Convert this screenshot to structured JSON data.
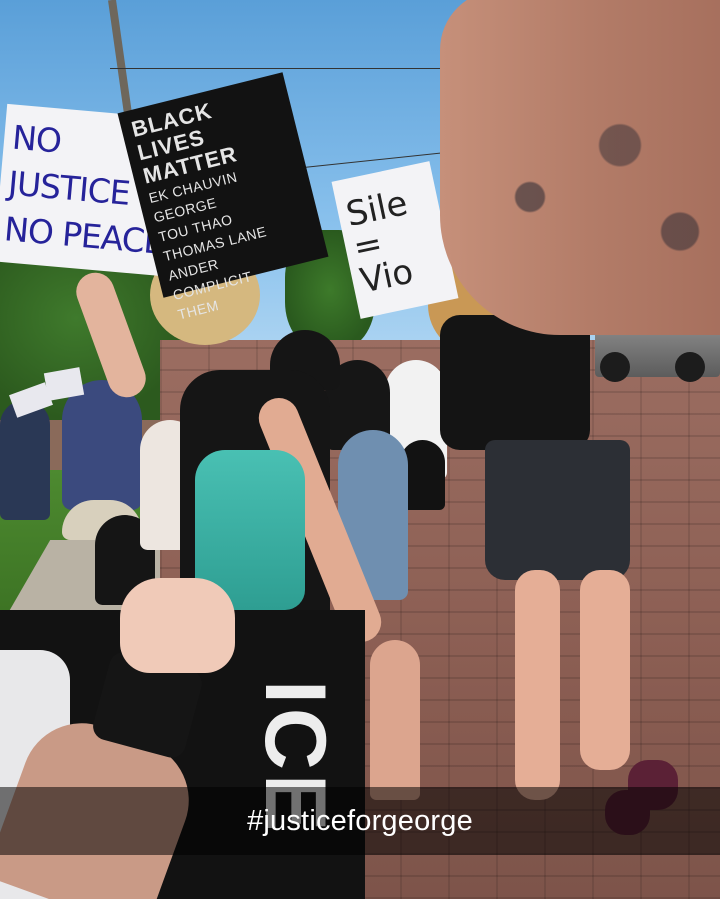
{
  "photo": {
    "description_icon": "protest-march-photo-icon"
  },
  "signs": {
    "no_justice": {
      "line1": "NO JUSTICE",
      "line2": "NO PEACE"
    },
    "black_lives": {
      "line1": "BLACK LIVES",
      "line2": "MATTER",
      "names": [
        "EK CHAUVIN",
        "GEORGE",
        "TOU THAO",
        "THOMAS LANE",
        "ANDER",
        "COMPLICIT",
        "THEM"
      ]
    },
    "silence": {
      "line1": "Sile",
      "line2": "=",
      "line3": "Vio"
    },
    "front": {
      "text": "ICE"
    }
  },
  "caption": {
    "text": "#justiceforgeorge"
  },
  "colors": {
    "sign_ink": "#26239a",
    "caption_bg": "#000000",
    "caption_fg": "#ffffff"
  }
}
